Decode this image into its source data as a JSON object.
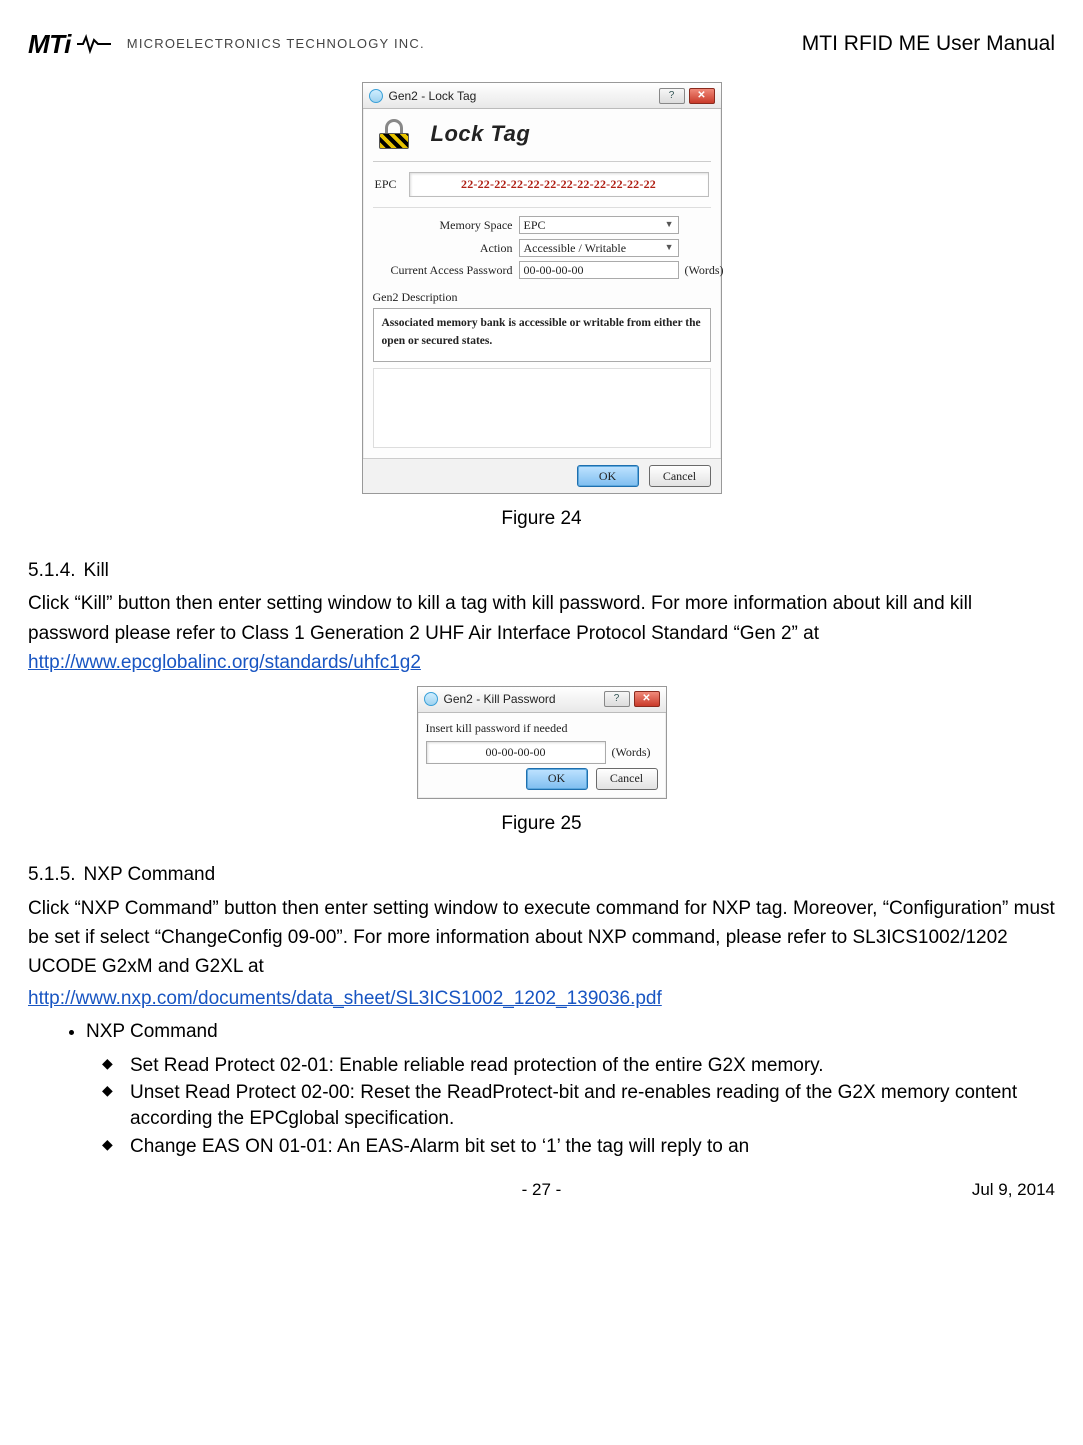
{
  "header": {
    "logo_text": "MTi",
    "logo_subtext": "MICROELECTRONICS TECHNOLOGY INC.",
    "doc_title": "MTI RFID ME User Manual"
  },
  "figure24": {
    "titlebar_text": "Gen2 - Lock Tag",
    "help_glyph": "?",
    "close_glyph": "✕",
    "big_title": "Lock Tag",
    "epc_label": "EPC",
    "epc_value": "22-22-22-22-22-22-22-22-22-22-22-22",
    "row_mem_label": "Memory Space",
    "row_mem_value": "EPC",
    "row_action_label": "Action",
    "row_action_value": "Accessible / Writable",
    "row_pwd_label": "Current Access Password",
    "row_pwd_value": "00-00-00-00",
    "row_pwd_unit": "(Words)",
    "gen2_desc_label": "Gen2 Description",
    "gen2_desc_text": "Associated memory bank is accessible or writable from either the open or secured states.",
    "ok_label": "OK",
    "cancel_label": "Cancel",
    "caption": "Figure 24"
  },
  "section_kill": {
    "num": "5.1.4.",
    "title": "Kill",
    "para_a": "Click “Kill” button then enter setting window to kill a tag with kill password. For more information about kill and kill password please refer to Class 1 Generation 2 UHF Air Interface Protocol Standard “Gen 2” at ",
    "link": "http://www.epcglobalinc.org/standards/uhfc1g2"
  },
  "figure25": {
    "titlebar_text": "Gen2 - Kill Password",
    "help_glyph": "?",
    "close_glyph": "✕",
    "prompt": "Insert kill password if needed",
    "value": "00-00-00-00",
    "unit": "(Words)",
    "ok_label": "OK",
    "cancel_label": "Cancel",
    "caption": "Figure 25"
  },
  "section_nxp": {
    "num": "5.1.5.",
    "title": "NXP Command",
    "para_a": "Click “NXP Command” button then enter setting window to execute command for NXP tag. Moreover, “Configuration” must be set if select “ChangeConfig 09-00”. For more information about NXP command, please refer to SL3ICS1002/1202 UCODE G2xM and G2XL at",
    "link": "http://www.nxp.com/documents/data_sheet/SL3ICS1002_1202_139036.pdf",
    "list_l1_0": "NXP Command",
    "list_l2_0": "Set Read Protect 02-01: Enable reliable read protection of the entire G2X memory.",
    "list_l2_1": "Unset Read Protect 02-00: Reset the ReadProtect-bit and re-enables reading of the G2X memory content according the EPCglobal specification.",
    "list_l2_2": "Change EAS ON 01-01: An EAS-Alarm bit set to ‘1’ the tag will reply to an"
  },
  "footer": {
    "page": "-  27  -",
    "date": "Jul  9,  2014"
  }
}
